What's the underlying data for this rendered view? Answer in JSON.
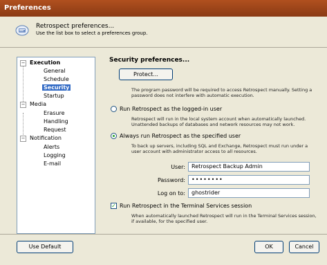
{
  "window": {
    "title": "Preferences"
  },
  "header": {
    "title": "Retrospect preferences...",
    "subtitle": "Use the list box to select a preferences group."
  },
  "tree": {
    "execution": {
      "label": "Execution",
      "children": [
        "General",
        "Schedule",
        "Security",
        "Startup"
      ]
    },
    "media": {
      "label": "Media",
      "children": [
        "Erasure",
        "Handling",
        "Request"
      ]
    },
    "notification": {
      "label": "Notification",
      "children": [
        "Alerts",
        "Logging",
        "E-mail"
      ]
    },
    "selected": "Security"
  },
  "panel": {
    "heading": "Security preferences...",
    "protect_button": "Protect...",
    "protect_desc": "The program password will be required to access Retrospect manually. Setting a password does not interfere with automatic execution.",
    "option_logged_in": "Run Retrospect as the logged-in user",
    "logged_in_desc": "Retrospect will run in the local system account when automatically launched. Unattended backups of databases and network resources may not work.",
    "option_specified": "Always run Retrospect as the specified user",
    "specified_desc": "To back up servers, including SQL and Exchange, Retrospect must run under a user account with administrator access to all resources.",
    "user_label": "User:",
    "user_value": "Retrospect Backup Admin",
    "password_label": "Password:",
    "password_value": "••••••••",
    "logon_label": "Log on to:",
    "logon_value": "ghostrider",
    "terminal_option": "Run Retrospect in the Terminal Services session",
    "terminal_desc": "When automatically launched Retrospect will run in the Terminal Services session, if available, for the specified user.",
    "selected_run_mode": "specified",
    "terminal_checked": true
  },
  "footer": {
    "use_default": "Use Default",
    "ok": "OK",
    "cancel": "Cancel"
  }
}
